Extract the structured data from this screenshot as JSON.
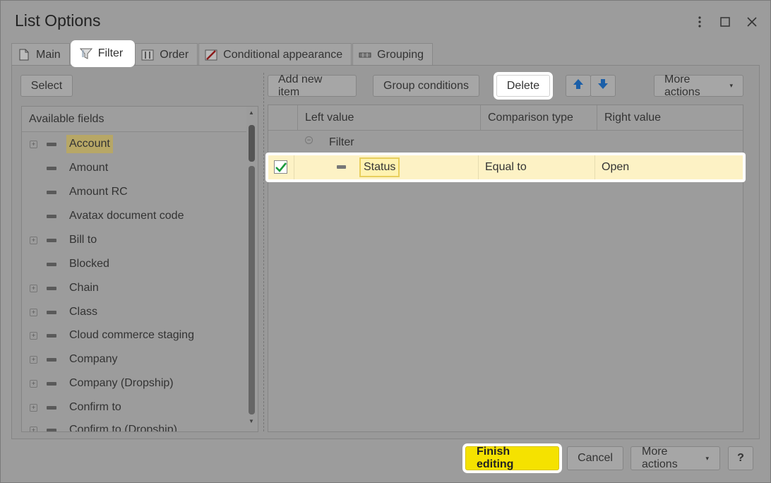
{
  "window": {
    "title": "List Options",
    "menu_icon": "more-vertical-icon",
    "maximize_icon": "maximize-icon",
    "close_icon": "close-icon"
  },
  "tabs": [
    {
      "label": "Main",
      "icon": "document-icon"
    },
    {
      "label": "Filter",
      "icon": "filter-icon",
      "active": true
    },
    {
      "label": "Order",
      "icon": "sort-icon"
    },
    {
      "label": "Conditional appearance",
      "icon": "conditional-appearance-icon"
    },
    {
      "label": "Grouping",
      "icon": "grouping-icon"
    }
  ],
  "left_toolbar": {
    "select_label": "Select"
  },
  "fields": {
    "header": "Available fields",
    "items": [
      {
        "label": "Account",
        "expandable": true,
        "highlighted": true
      },
      {
        "label": "Amount",
        "expandable": false
      },
      {
        "label": "Amount RC",
        "expandable": false
      },
      {
        "label": "Avatax document code",
        "expandable": false
      },
      {
        "label": "Bill to",
        "expandable": true
      },
      {
        "label": "Blocked",
        "expandable": false
      },
      {
        "label": "Chain",
        "expandable": true
      },
      {
        "label": "Class",
        "expandable": true
      },
      {
        "label": "Cloud commerce staging",
        "expandable": true
      },
      {
        "label": "Company",
        "expandable": true
      },
      {
        "label": "Company (Dropship)",
        "expandable": true
      },
      {
        "label": "Confirm to",
        "expandable": true
      },
      {
        "label": "Confirm to (Dropship)",
        "expandable": true
      }
    ]
  },
  "right_toolbar": {
    "add_new_item": "Add new item",
    "group_conditions": "Group conditions",
    "delete": "Delete",
    "move_up_icon": "arrow-up-icon",
    "move_down_icon": "arrow-down-icon",
    "more_actions": "More actions"
  },
  "grid": {
    "columns": [
      "Left value",
      "Comparison type",
      "Right value"
    ],
    "root": "Filter",
    "rows": [
      {
        "checked": true,
        "left_value": "Status",
        "comparison": "Equal to",
        "right_value": "Open"
      }
    ]
  },
  "footer": {
    "finish_editing": "Finish editing",
    "cancel": "Cancel",
    "more_actions": "More actions",
    "help": "?"
  },
  "colors": {
    "accent_yellow": "#f5e200",
    "selected_row": "#fdf2c5",
    "check_green": "#1a9a3c"
  }
}
